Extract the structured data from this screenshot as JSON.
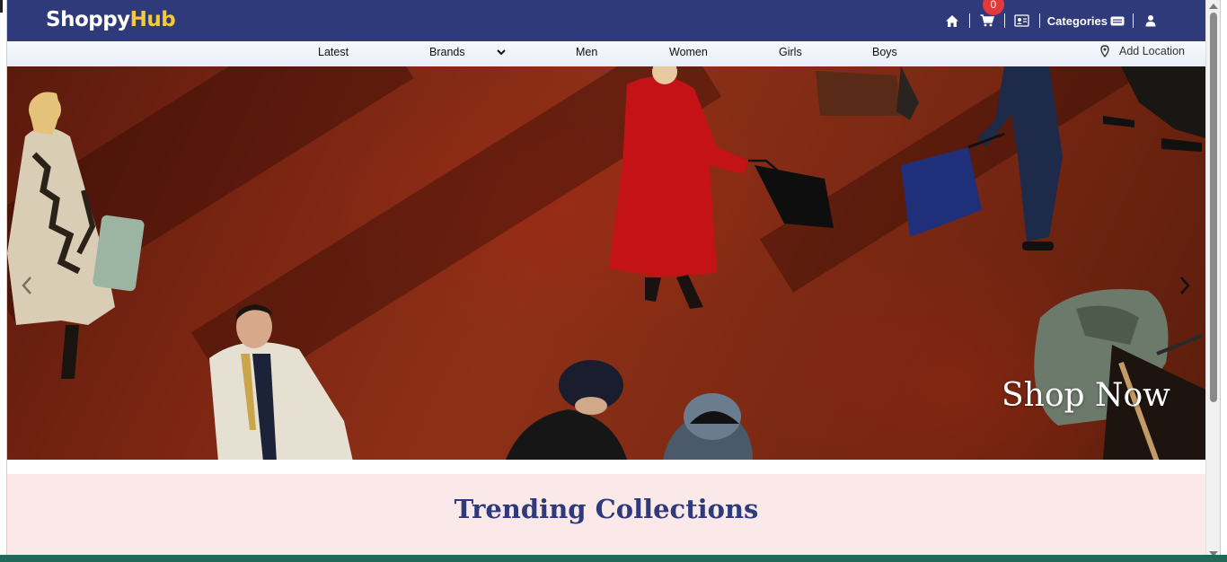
{
  "header": {
    "brand_part1": "Shoppy",
    "brand_part2": "Hub",
    "cart_count": "0",
    "categories_label": "Categories"
  },
  "nav": {
    "items": [
      "Latest",
      "Brands",
      "Men",
      "Women",
      "Girls",
      "Boys"
    ],
    "add_location": "Add Location"
  },
  "hero": {
    "cta": "Shop Now"
  },
  "trending": {
    "title": "Trending Collections"
  },
  "colors": {
    "header_bg": "#2e3a7a",
    "brand_accent": "#f5c93a",
    "badge": "#e23a3a",
    "trending_bg": "#fbe9ea"
  },
  "icons": [
    "home-icon",
    "cart-icon",
    "id-card-icon",
    "menu-card-icon",
    "user-icon",
    "chevron-down-icon",
    "location-pin-icon",
    "chevron-left-icon",
    "chevron-right-icon"
  ]
}
